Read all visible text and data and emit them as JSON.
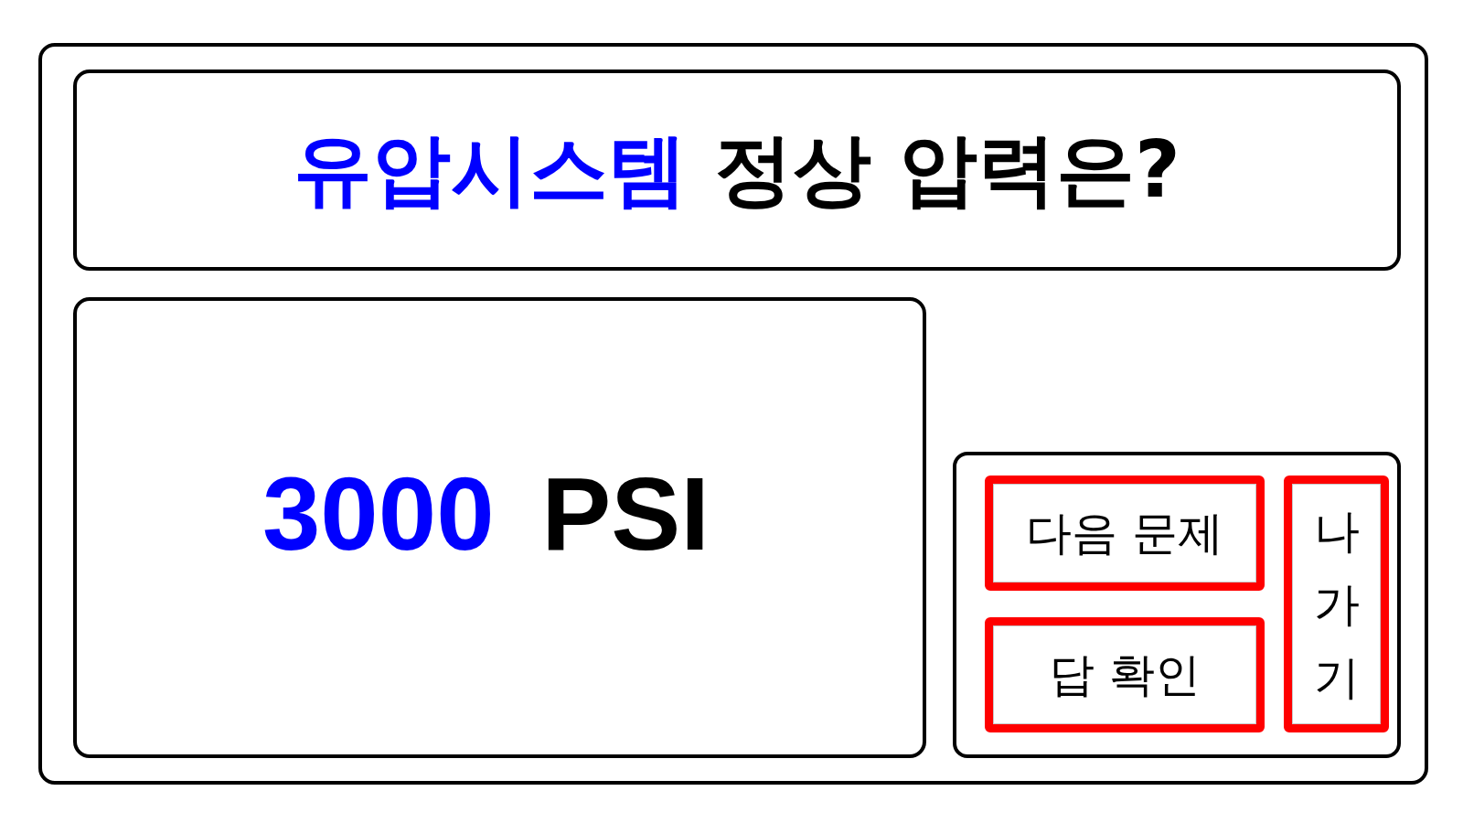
{
  "question": {
    "highlight": "유압시스템",
    "text": "정상 압력은?"
  },
  "answer": {
    "value": "3000",
    "unit": "PSI"
  },
  "buttons": [
    {
      "label": "다음 문제",
      "kind": "horizontal"
    },
    {
      "label": "답 확인",
      "kind": "horizontal"
    },
    {
      "label": "나가기",
      "kind": "vertical"
    }
  ]
}
